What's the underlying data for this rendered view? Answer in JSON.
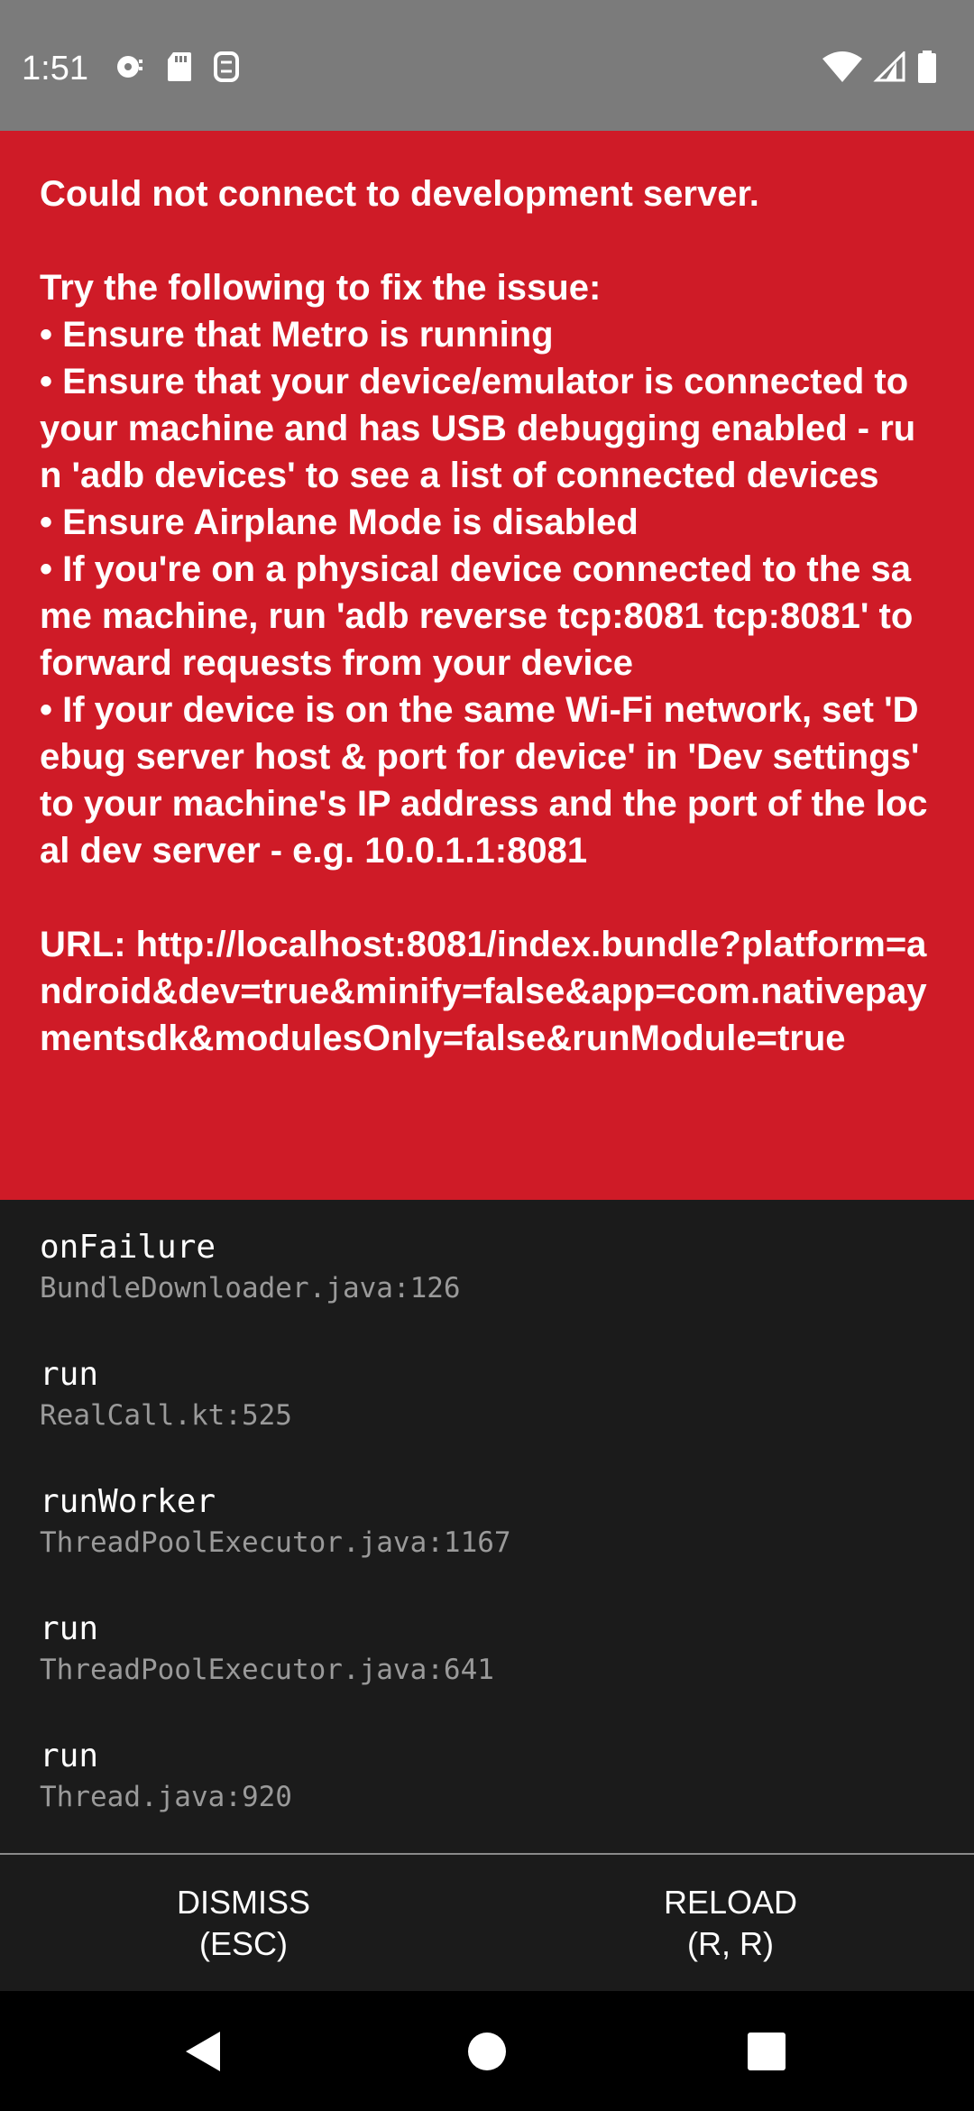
{
  "status_bar": {
    "time": "1:51",
    "left_icons": [
      "location-sync-icon",
      "sd-card-icon",
      "debug-icon"
    ],
    "right_icons": [
      "wifi-icon",
      "signal-icon",
      "battery-icon"
    ]
  },
  "error": {
    "message": "Could not connect to development server.\n\nTry the following to fix the issue:\n• Ensure that Metro is running\n• Ensure that your device/emulator is connected to your machine and has USB debugging enabled - run 'adb devices' to see a list of connected devices\n• Ensure Airplane Mode is disabled\n• If you're on a physical device connected to the same machine, run 'adb reverse tcp:8081 tcp:8081' to forward requests from your device\n• If your device is on the same Wi-Fi network, set 'Debug server host & port for device' in 'Dev settings' to your machine's IP address and the port of the local dev server - e.g. 10.0.1.1:8081\n\nURL: http://localhost:8081/index.bundle?platform=android&dev=true&minify=false&app=com.nativepaymentsdk&modulesOnly=false&runModule=true",
    "background_color": "#cf1b27"
  },
  "stack": [
    {
      "method": "onFailure",
      "file": "BundleDownloader.java:126"
    },
    {
      "method": "run",
      "file": "RealCall.kt:525"
    },
    {
      "method": "runWorker",
      "file": "ThreadPoolExecutor.java:1167"
    },
    {
      "method": "run",
      "file": "ThreadPoolExecutor.java:641"
    },
    {
      "method": "run",
      "file": "Thread.java:920"
    }
  ],
  "buttons": {
    "dismiss": {
      "label": "DISMISS",
      "shortcut": "(ESC)"
    },
    "reload": {
      "label": "RELOAD",
      "shortcut": "(R, R)"
    }
  },
  "nav_bar": {
    "icons": [
      "back-icon",
      "home-icon",
      "recents-icon"
    ]
  }
}
